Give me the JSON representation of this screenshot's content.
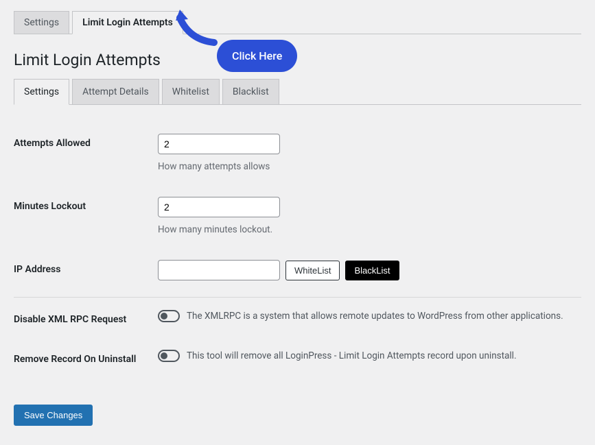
{
  "top_tabs": {
    "settings": "Settings",
    "limit_login": "Limit Login Attempts"
  },
  "callout": {
    "label": "Click Here"
  },
  "page_title": "Limit Login Attempts",
  "sub_tabs": {
    "settings": "Settings",
    "attempt_details": "Attempt Details",
    "whitelist": "Whitelist",
    "blacklist": "Blacklist"
  },
  "fields": {
    "attempts_allowed": {
      "label": "Attempts Allowed",
      "value": "2",
      "desc": "How many attempts allows"
    },
    "minutes_lockout": {
      "label": "Minutes Lockout",
      "value": "2",
      "desc": "How many minutes lockout."
    },
    "ip_address": {
      "label": "IP Address",
      "value": "",
      "whitelist_btn": "WhiteList",
      "blacklist_btn": "BlackList"
    },
    "disable_xmlrpc": {
      "label": "Disable XML RPC Request",
      "desc": "The XMLRPC is a system that allows remote updates to WordPress from other applications."
    },
    "remove_record": {
      "label": "Remove Record On Uninstall",
      "desc": "This tool will remove all LoginPress - Limit Login Attempts record upon uninstall."
    }
  },
  "save_button": "Save Changes"
}
